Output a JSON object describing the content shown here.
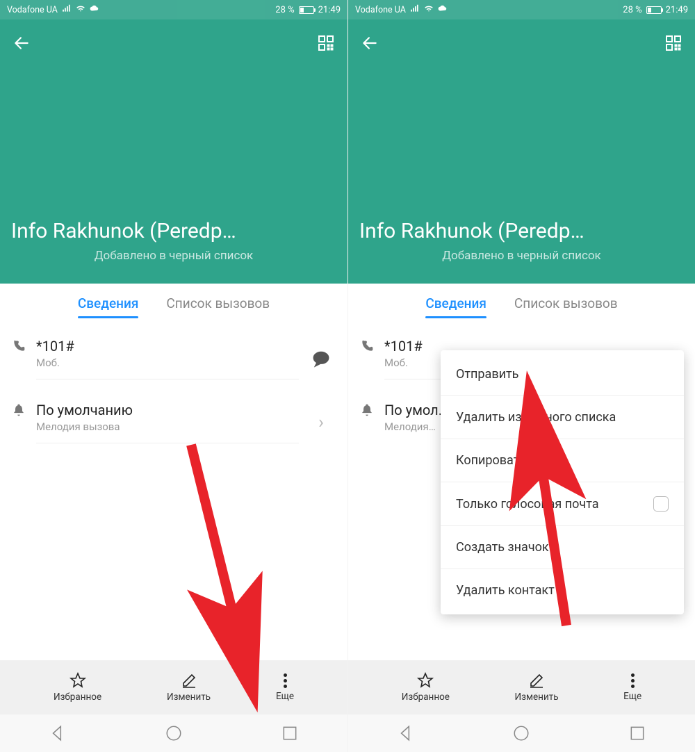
{
  "status": {
    "carrier": "Vodafone UA",
    "battery_pct": "28 %",
    "time": "21:49"
  },
  "contact": {
    "name": "Info Rakhunok (Peredp…",
    "subtitle": "Добавлено в черный список"
  },
  "tabs": {
    "details": "Сведения",
    "calllog": "Список вызовов"
  },
  "phone_row": {
    "number": "*101#",
    "type": "Моб."
  },
  "ringtone_row": {
    "title": "По умолчанию",
    "title_trunc": "По умол…",
    "sub": "Мелодия вызова",
    "sub_trunc": "Мелодия…"
  },
  "bottom": {
    "fav": "Избранное",
    "edit": "Изменить",
    "more": "Еще"
  },
  "menu": {
    "items": [
      "Отправить",
      "Удалить из черного списка",
      "Копировать",
      "Только голосовая почта",
      "Создать значок",
      "Удалить контакт"
    ]
  }
}
